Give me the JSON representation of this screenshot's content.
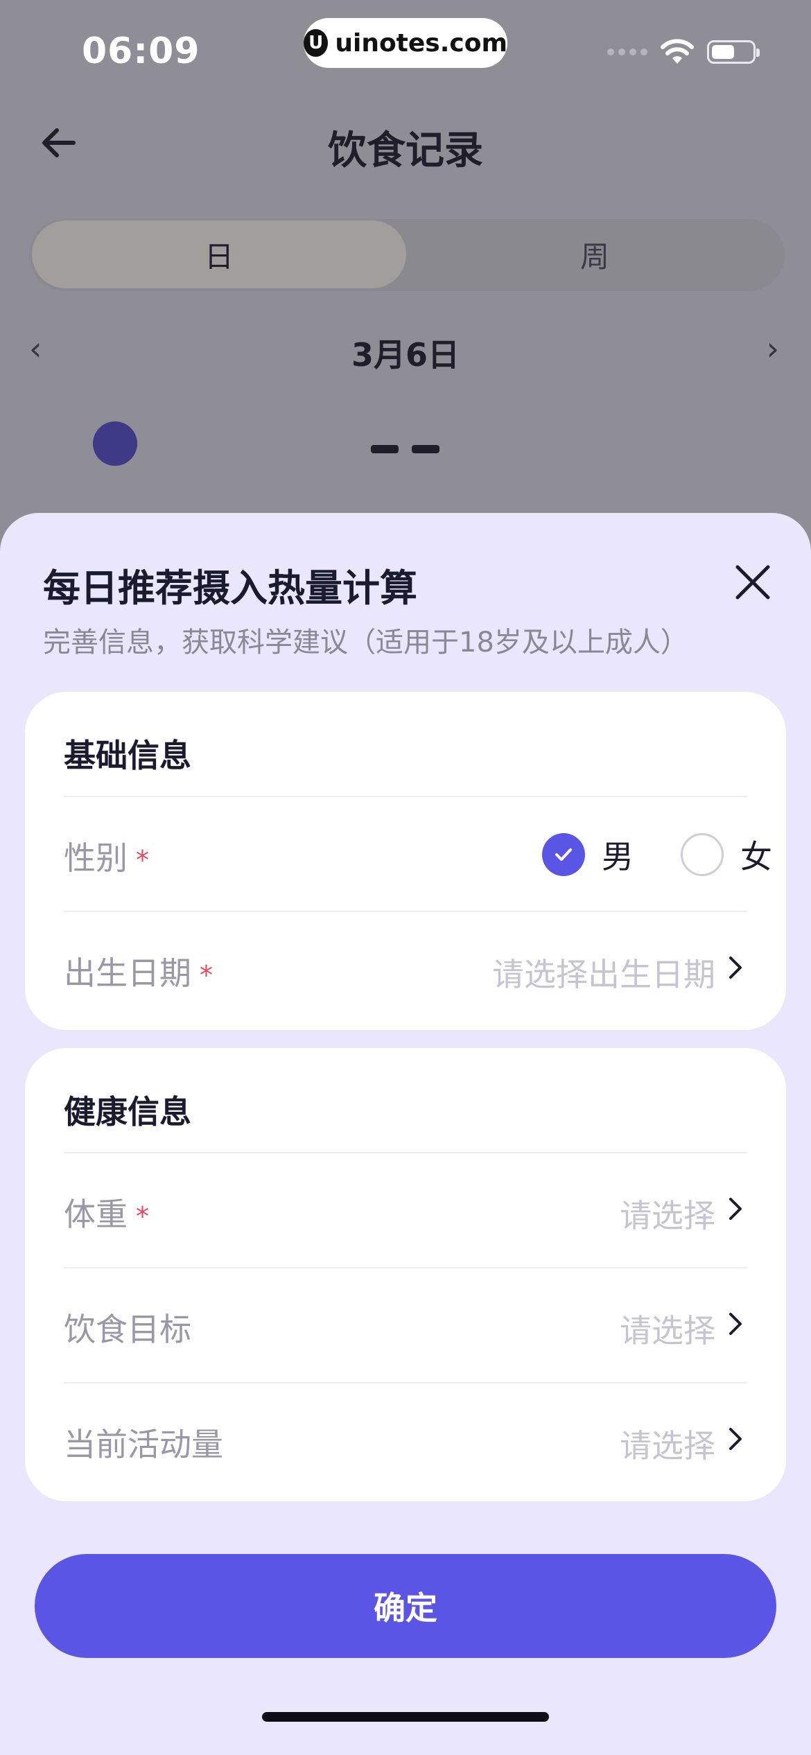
{
  "status_bar": {
    "time": "06:09",
    "url_logo": "U",
    "url": "uinotes.com",
    "icons": [
      "signal-dots-icon",
      "wifi-icon",
      "battery-icon"
    ]
  },
  "nav": {
    "title": "饮食记录",
    "back_icon": "arrow-left-icon"
  },
  "segment": {
    "active": "日",
    "inactive": "周"
  },
  "date_nav": {
    "prev": "‹",
    "date": "3月6日",
    "next": "›"
  },
  "sheet": {
    "title": "每日推荐摄入热量计算",
    "subtitle": "完善信息，获取科学建议（适用于18岁及以上成人）",
    "close_icon": "close-icon",
    "basic": {
      "title": "基础信息",
      "gender": {
        "label": "性别",
        "required": "*",
        "options": [
          "男",
          "女"
        ],
        "selected": "男"
      },
      "birth": {
        "label": "出生日期",
        "required": "*",
        "placeholder": "请选择出生日期"
      }
    },
    "health": {
      "title": "健康信息",
      "weight": {
        "label": "体重",
        "required": "*",
        "placeholder": "请选择"
      },
      "goal": {
        "label": "饮食目标",
        "placeholder": "请选择"
      },
      "activity": {
        "label": "当前活动量",
        "placeholder": "请选择"
      }
    },
    "confirm_label": "确定"
  },
  "colors": {
    "accent": "#5b55e6",
    "sheet_bg": "#eae7fd",
    "required": "#e4485c",
    "placeholder": "#c6c4d0"
  }
}
